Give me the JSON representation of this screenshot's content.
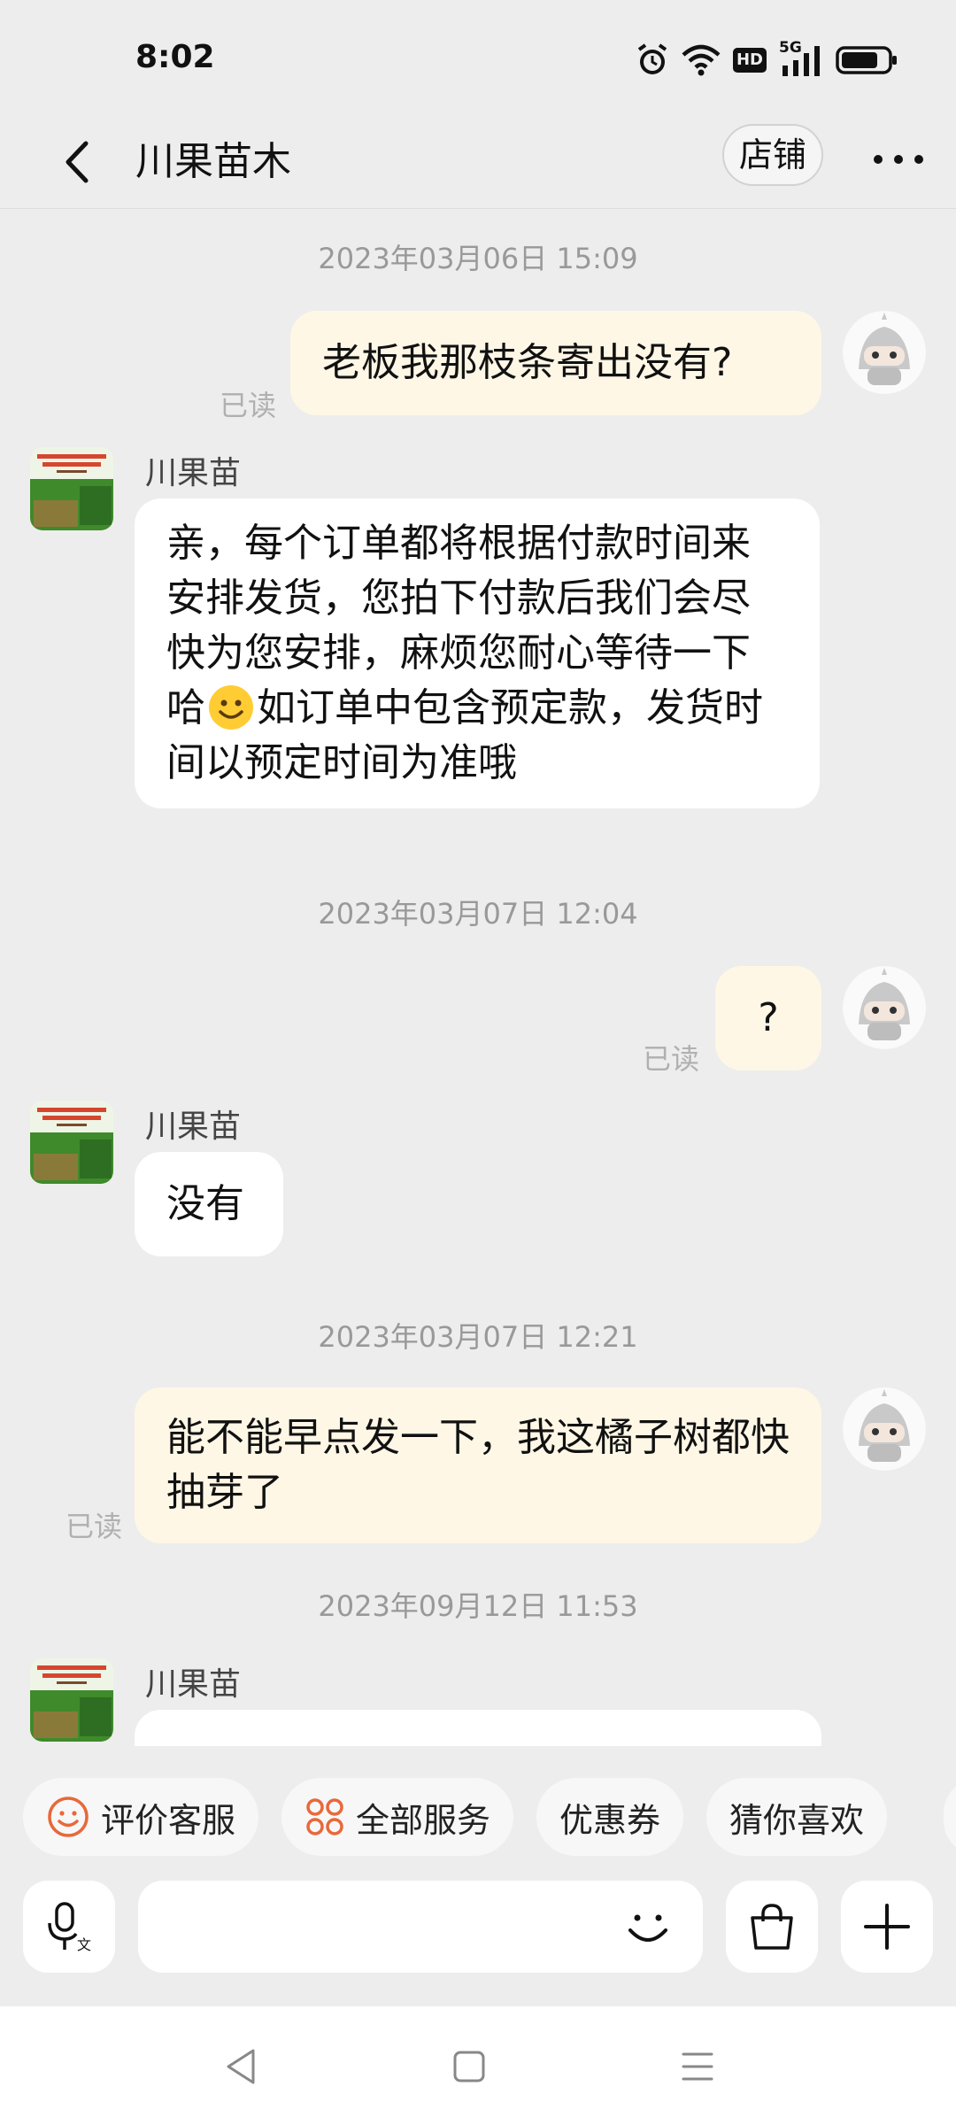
{
  "status_bar": {
    "time": "8:02",
    "hd_label": "HD",
    "network_label": "5G"
  },
  "header": {
    "title": "川果苗木",
    "shop_label": "店铺"
  },
  "messages": [
    {
      "timestamp": "2023年03月06日 15:09"
    },
    {
      "text": "老板我那枝条寄出没有?",
      "read_label": "已读"
    },
    {
      "sender": "川果苗",
      "text_part1": "亲，每个订单都将根据付款时间来安排发货，您拍下付款后我们会尽快为您安排，麻烦您耐心等待一下哈",
      "text_part2": "如订单中包含预定款，发货时间以预定时间为准哦"
    },
    {
      "timestamp": "2023年03月07日 12:04"
    },
    {
      "text": "?",
      "read_label": "已读"
    },
    {
      "sender": "川果苗",
      "text": "没有"
    },
    {
      "timestamp": "2023年03月07日 12:21"
    },
    {
      "text": "能不能早点发一下，我这橘子树都快抽芽了",
      "read_label": "已读"
    },
    {
      "timestamp": "2023年09月12日 11:53"
    },
    {
      "sender": "川果苗"
    }
  ],
  "quick_actions": [
    "评价客服",
    "全部服务",
    "优惠券",
    "猜你喜欢"
  ],
  "input": {
    "placeholder": ""
  },
  "colors": {
    "accent": "#e8683a",
    "outgoing_bubble": "#fff7e6",
    "background": "#ededed"
  },
  "icons": [
    "back-icon",
    "more-icon",
    "voice-input-icon",
    "emoji-icon",
    "shopping-bag-icon",
    "plus-icon"
  ]
}
